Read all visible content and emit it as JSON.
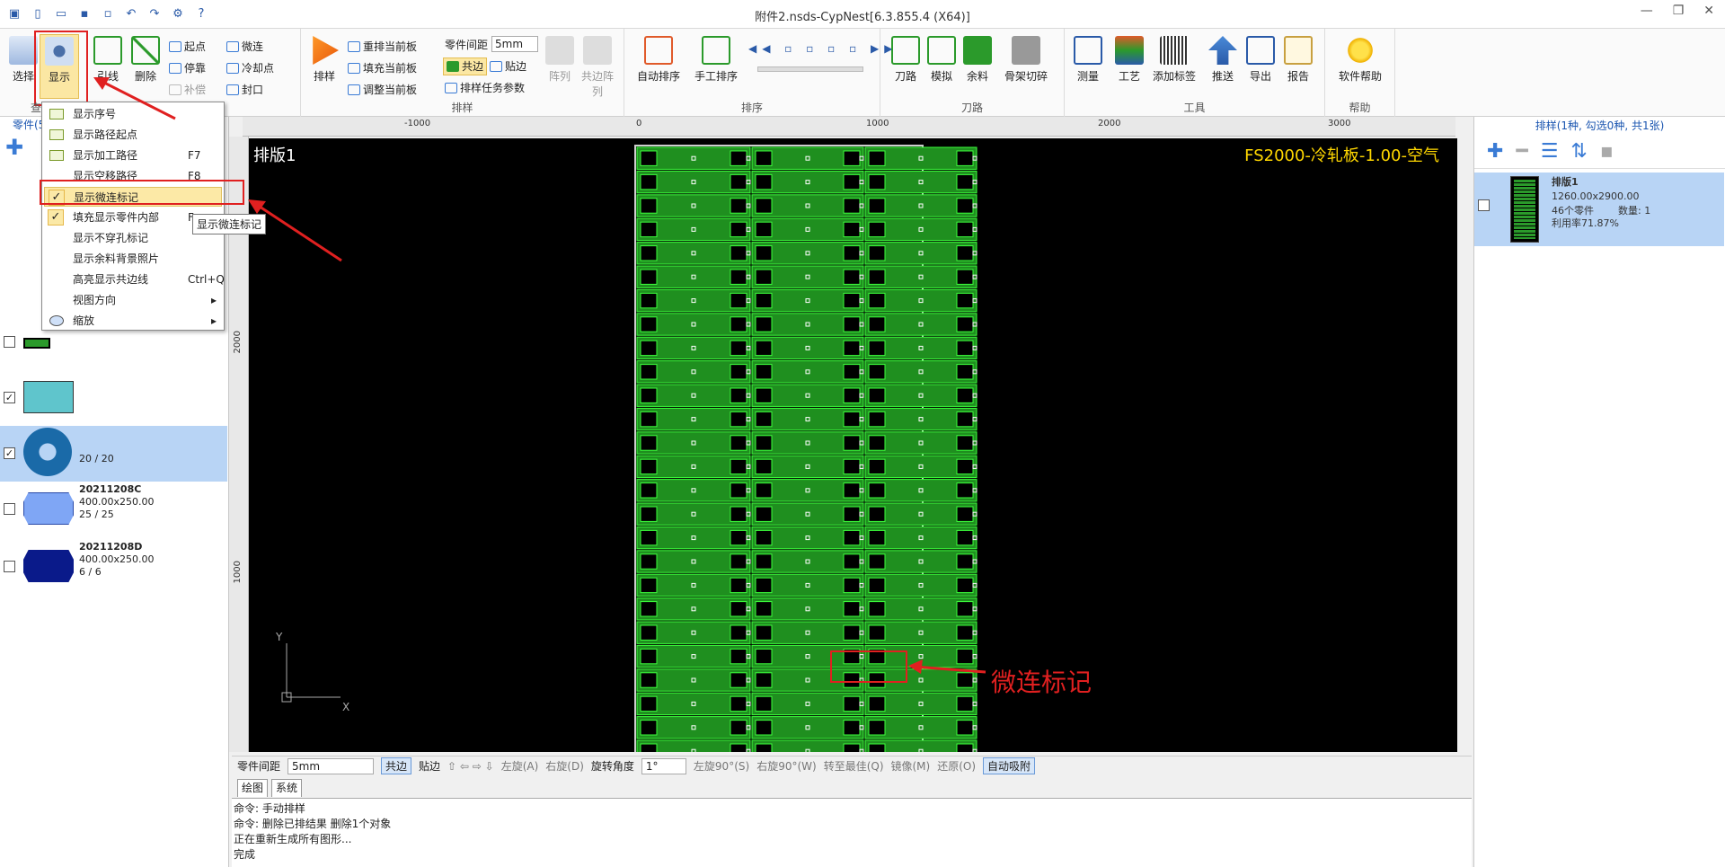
{
  "window": {
    "title": "附件2.nsds-CypNest[6.3.855.4 (X64)]",
    "min": "—",
    "max": "❐",
    "close": "✕"
  },
  "ribbon": {
    "select": "选择",
    "display": "显示",
    "lead": "引线",
    "delete": "删除",
    "start": "起点",
    "stop": "停靠",
    "compensate": "补偿",
    "microjoint": "微连",
    "cooling": "冷却点",
    "seal": "封口",
    "view_group": "查",
    "nest": "排样",
    "reorder": "重排当前板",
    "fill": "填充当前板",
    "adjust": "调整当前板",
    "spacing_label": "零件间距",
    "spacing_value": "5mm",
    "common_edge": "共边",
    "stick": "贴边",
    "nest_params": "排样任务参数",
    "array": "阵列",
    "common_array": "共边阵列",
    "nest_group": "排样",
    "auto_sort": "自动排序",
    "manual_sort": "手工排序",
    "sort_group": "排序",
    "toolpath": "刀路",
    "simulate": "模拟",
    "remnant": "余料",
    "skeleton": "骨架切碎",
    "toolpath_group": "刀路",
    "measure": "测量",
    "craft": "工艺",
    "add_label": "添加标签",
    "push": "推送",
    "export": "导出",
    "report": "报告",
    "tools_group": "工具",
    "help": "软件帮助",
    "help_group": "帮助"
  },
  "left_panel": {
    "header": "零件(5",
    "parts": [
      {
        "name": "",
        "size": "",
        "count": "",
        "checked": false
      },
      {
        "name": "",
        "size": "",
        "count": "",
        "checked": true
      },
      {
        "name": "",
        "size": "",
        "count": "20 / 20",
        "checked": true
      },
      {
        "name": "20211208C",
        "size": "400.00x250.00",
        "count": "25 / 25",
        "checked": false
      },
      {
        "name": "20211208D",
        "size": "400.00x250.00",
        "count": "6 / 6",
        "checked": false
      }
    ]
  },
  "menu": {
    "items": [
      {
        "label": "显示序号",
        "shortcut": "",
        "checked": false
      },
      {
        "label": "显示路径起点",
        "shortcut": "",
        "checked": false
      },
      {
        "label": "显示加工路径",
        "shortcut": "F7",
        "checked": false
      },
      {
        "label": "显示空移路径",
        "shortcut": "F8",
        "checked": false
      },
      {
        "label": "显示微连标记",
        "shortcut": "",
        "checked": true
      },
      {
        "label": "填充显示零件内部",
        "shortcut": "F",
        "checked": true
      },
      {
        "label": "显示不穿孔标记",
        "shortcut": "",
        "checked": false
      },
      {
        "label": "显示余料背景照片",
        "shortcut": "",
        "checked": false
      },
      {
        "label": "高亮显示共边线",
        "shortcut": "Ctrl+Q",
        "checked": false
      },
      {
        "label": "视图方向",
        "shortcut": "",
        "checked": false
      },
      {
        "label": "缩放",
        "shortcut": "",
        "checked": false
      }
    ],
    "tooltip": "显示微连标记"
  },
  "canvas": {
    "sheet_name": "排版1",
    "material": "FS2000-冷轧板-1.00-空气",
    "annotation": "微连标记",
    "axis_y": "Y",
    "axis_x": "X",
    "ruler_h": [
      "-1000",
      "0",
      "1000",
      "2000",
      "3000"
    ],
    "ruler_v": [
      "2000",
      "1000"
    ]
  },
  "right_panel": {
    "header": "排样(1种, 勾选0种, 共1张)",
    "nest": {
      "name": "排版1",
      "size": "1260.00x2900.00",
      "parts": "46个零件",
      "qty": "数量: 1",
      "util": "利用率71.87%"
    }
  },
  "bottom_toolbar": {
    "spacing_label": "零件间距",
    "spacing_value": "5mm",
    "common_edge": "共边",
    "stick": "贴边",
    "rot_left": "左旋(A)",
    "rot_right": "右旋(D)",
    "rot_angle_label": "旋转角度",
    "rot_angle": "1°",
    "left90": "左旋90°(S)",
    "right90": "右旋90°(W)",
    "to_best": "转至最佳(Q)",
    "mirror": "镜像(M)",
    "restore": "还原(O)",
    "auto_snap": "自动吸附"
  },
  "tabs": [
    "绘图",
    "系统"
  ],
  "command_log": [
    "命令: 手动排样",
    "命令: 删除已排结果    删除1个对象",
    "正在重新生成所有图形...",
    "完成"
  ],
  "colors": {
    "accent": "#1a55b0",
    "highlight": "#e02020",
    "part_fill": "#1f8f1f",
    "canvas_bg": "#000000"
  }
}
